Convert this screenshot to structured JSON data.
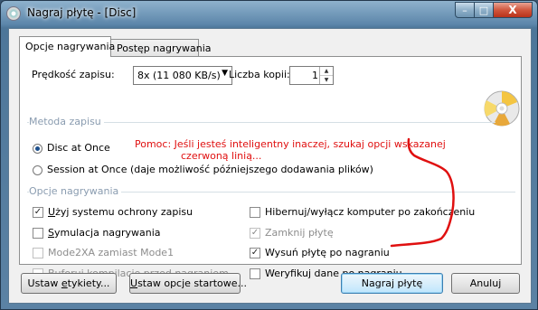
{
  "window": {
    "title": "Nagraj płytę - [Disc]",
    "controls": {
      "minimize": "–",
      "maximize": "□",
      "close": "X"
    }
  },
  "tabs": [
    {
      "label": "Opcje nagrywania",
      "active": true
    },
    {
      "label": "Postęp nagrywania",
      "active": false
    }
  ],
  "speed": {
    "label": "Prędkość zapisu:",
    "value": "8x (11 080 KB/s)"
  },
  "copies": {
    "label": "Liczba kopii:",
    "value": "1"
  },
  "method_group": {
    "label": "Metoda zapisu",
    "options": [
      {
        "label": "Disc at Once",
        "selected": true
      },
      {
        "label": "Session at Once (daje możliwość późniejszego dodawania plików)",
        "selected": false
      }
    ]
  },
  "annotation": {
    "line1": "Pomoc: Jeśli jesteś inteligentny inaczej, szukaj opcji wskazanej",
    "line2": "czerwoną linią...",
    "color": "#e01010"
  },
  "burn_group": {
    "label": "Opcje nagrywania",
    "left": [
      {
        "label": "Użyj systemu ochrony zapisu",
        "checked": true,
        "enabled": true
      },
      {
        "label": "Symulacja nagrywania",
        "checked": false,
        "enabled": true
      },
      {
        "label": "Mode2XA zamiast Mode1",
        "checked": false,
        "enabled": false
      },
      {
        "label": "Buforuj kompilację przed nagraniem",
        "checked": false,
        "enabled": false
      }
    ],
    "right": [
      {
        "label": "Hibernuj/wyłącz komputer po zakończeniu",
        "checked": false,
        "enabled": true
      },
      {
        "label": "Zamknij płytę",
        "checked": true,
        "enabled": false
      },
      {
        "label": "Wysuń płytę po nagraniu",
        "checked": true,
        "enabled": true
      },
      {
        "label": "Weryfikuj dane po nagraniu",
        "checked": false,
        "enabled": true
      }
    ]
  },
  "buttons": {
    "labels": "Ustaw etykiety...",
    "startup": "Ustaw opcje startowe...",
    "burn": "Nagraj płytę",
    "cancel": "Anuluj"
  },
  "icons": {
    "app": "disc-icon",
    "logo": "disc-burn-icon",
    "check": "✓"
  }
}
